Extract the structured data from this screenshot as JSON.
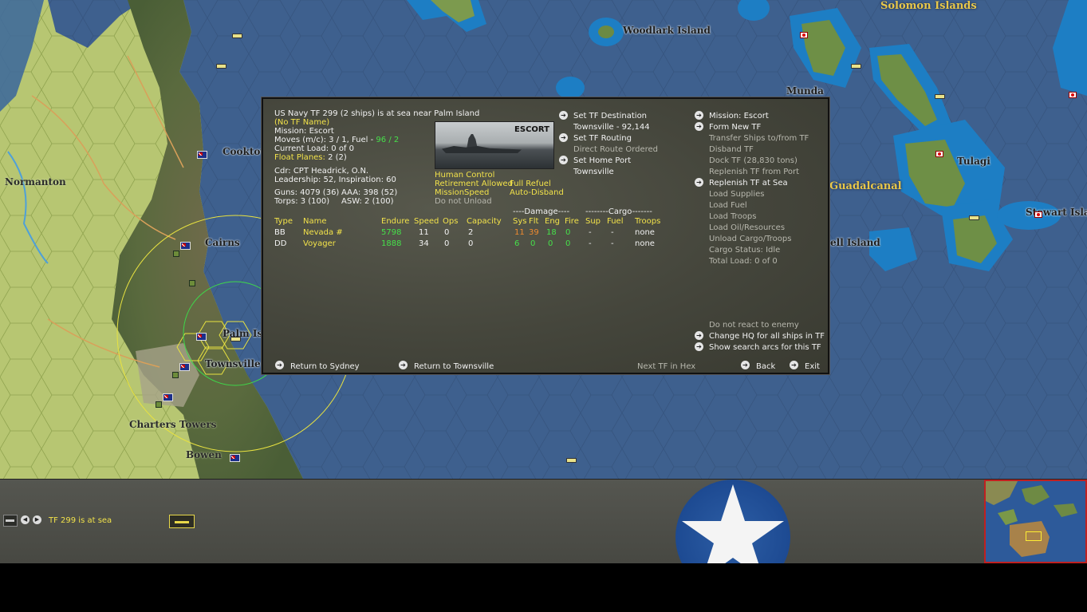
{
  "map": {
    "labels": {
      "solomon_islands": "Solomon Islands",
      "woodlark_island": "Woodlark Island",
      "munda": "Munda",
      "tulagi": "Tulagi",
      "guadalcanal": "Guadalcanal",
      "stewart_islands": "Stewart Islan",
      "bell_island": "ell Island",
      "cooktown": "Cooktow",
      "normanton": "Normanton",
      "cairns": "Cairns",
      "palm_island": "Palm Isl",
      "townsville": "Townsville",
      "charters_towers": "Charters Towers",
      "bowen": "Bowen"
    }
  },
  "dialog": {
    "header": {
      "line1": "US Navy TF 299 (2 ships) is at sea near Palm Island",
      "tf_name": "(No TF Name)",
      "mission": "Mission: Escort",
      "moves_prefix": "Moves (m/c): 3 / 1, Fuel - ",
      "moves_fuel": "96 / 2",
      "current_load": "Current Load: 0 of 0",
      "float_planes_label": "Float Planes:",
      "float_planes_value": " 2 (2)",
      "cdr": "Cdr: CPT Headrick, O.N.",
      "leadership": "Leadership: 52, Inspiration: 60",
      "guns": "Guns: 4079 (36)",
      "aaa": "AAA: 398 (52)",
      "torps": "Torps: 3 (100)",
      "asw": "ASW: 2 (100)"
    },
    "image_caption": "ESCORT",
    "settings": {
      "human_control": "Human Control",
      "full_refuel": "Full Refuel",
      "retirement_allowed": "Retirement Allowed",
      "auto_disband": "Auto-Disband",
      "mission_speed": "MissionSpeed",
      "do_not_unload": "Do not Unload"
    },
    "middle_menu": {
      "set_destination": "Set TF Destination",
      "destination_value": "Townsville - 92,144",
      "set_routing": "Set TF Routing",
      "routing_value": "Direct Route Ordered",
      "set_home_port": "Set Home Port",
      "home_port_value": "Townsville"
    },
    "right_menu": {
      "mission": "Mission: Escort",
      "form_new_tf": "Form New TF",
      "transfer_ships": "Transfer Ships to/from TF",
      "disband_tf": "Disband TF",
      "dock_tf": "Dock TF (28,830 tons)",
      "replenish_port": "Replenish TF from Port",
      "replenish_sea": "Replenish TF at Sea",
      "load_supplies": "Load Supplies",
      "load_fuel": "Load Fuel",
      "load_troops": "Load Troops",
      "load_oil": "Load Oil/Resources",
      "unload_cargo": "Unload Cargo/Troops",
      "cargo_status": "Cargo Status: Idle",
      "total_load": "Total Load: 0 of 0",
      "do_not_react": "Do not react to enemy",
      "change_hq": "Change HQ for all ships in TF",
      "show_search_arcs": "Show search arcs for this TF"
    },
    "table": {
      "group_damage": "----Damage----",
      "group_cargo": "--------Cargo-------",
      "headers": [
        "Type",
        "Name",
        "Endure",
        "Speed",
        "Ops",
        "Capacity",
        "Sys",
        "Flt",
        "Eng",
        "Fire",
        "Sup",
        "Fuel",
        "Troops"
      ],
      "rows": [
        [
          "BB",
          "Nevada #",
          "5798",
          "11",
          "0",
          "2",
          "11",
          "39",
          "18",
          "0",
          "-",
          "-",
          "none"
        ],
        [
          "DD",
          "Voyager",
          "1888",
          "34",
          "0",
          "0",
          "6",
          "0",
          "0",
          "0",
          "-",
          "-",
          "none"
        ]
      ]
    },
    "footer": {
      "return_sydney": "Return to Sydney",
      "return_townsville": "Return to Townsville",
      "next_tf": "Next TF in Hex",
      "back": "Back",
      "exit": "Exit"
    },
    "arrow_glyph": "➔"
  },
  "bottom_bar": {
    "status": "TF 299 is at sea",
    "prev_glyph": "◀",
    "next_glyph": "▶"
  },
  "colors": {
    "ocean": "#3d5f8c",
    "land": "#b8c773",
    "dialog_bg": "#47483e",
    "highlight_yellow": "#f2e24a",
    "value_green": "#46e04a",
    "value_orange": "#ee8a30"
  }
}
